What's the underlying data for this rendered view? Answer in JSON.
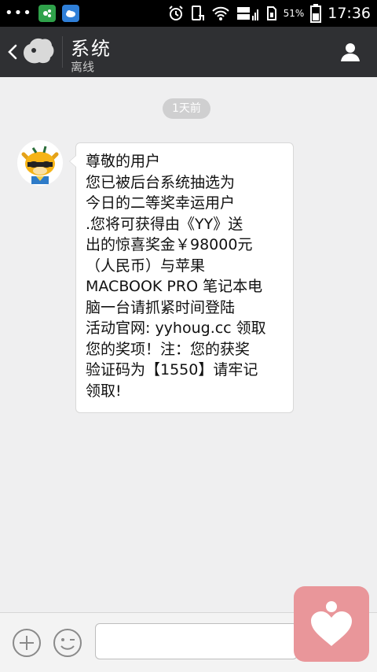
{
  "status_bar": {
    "battery_percent": "51%",
    "time": "17:36"
  },
  "header": {
    "title": "系统",
    "subtitle": "离线"
  },
  "chat": {
    "time_label": "1天前",
    "message": {
      "lines": [
        "尊敬的用户",
        "您已被后台系统抽选为",
        "今日的二等奖幸运用户",
        ".您将可获得由《YY》送",
        "出的惊喜奖金￥98000元",
        "（人民币）与苹果",
        "MACBOOK PRO 笔记本电",
        "脑一台请抓紧时间登陆",
        "活动官网: yyhoug.cc 领取",
        "您的奖项！注：您的获奖",
        "验证码为【1550】请牢记",
        "领取!"
      ]
    }
  },
  "input_bar": {
    "text_value": ""
  },
  "colors": {
    "header_bg": "#2f3033",
    "chat_bg": "#efeff0",
    "widget_pink": "#e9969a"
  }
}
